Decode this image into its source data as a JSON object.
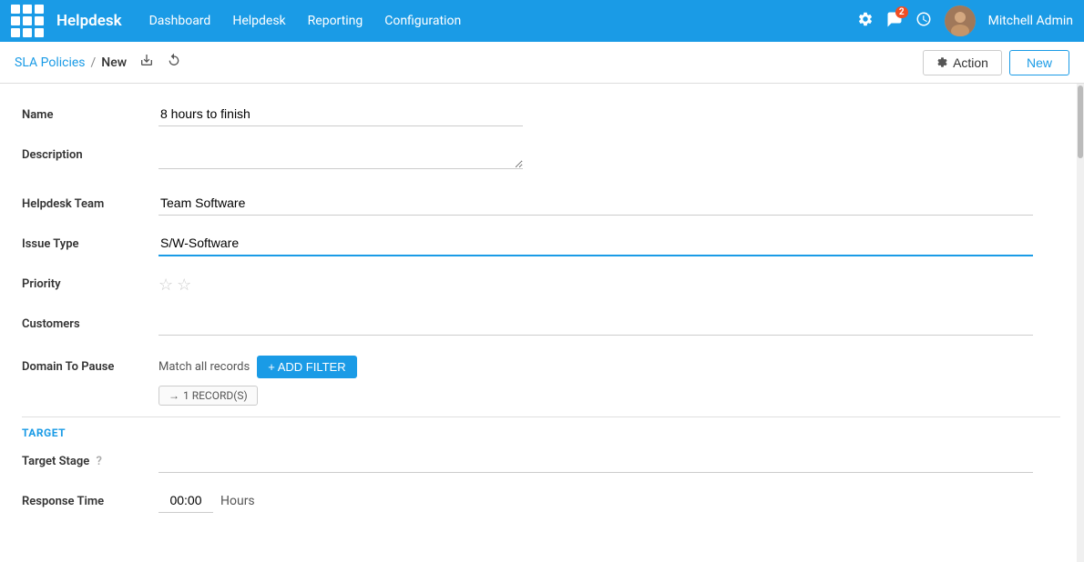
{
  "nav": {
    "app_icon": "grid-icon",
    "app_name": "Helpdesk",
    "links": [
      "Dashboard",
      "Helpdesk",
      "Reporting",
      "Configuration"
    ],
    "admin_name": "Mitchell Admin",
    "message_count": "2"
  },
  "breadcrumb": {
    "parent": "SLA Policies",
    "separator": "/",
    "current": "New",
    "action_label": "Action",
    "new_label": "New"
  },
  "form": {
    "name_label": "Name",
    "name_value": "8 hours to finish",
    "description_label": "Description",
    "helpdesk_team_label": "Helpdesk Team",
    "helpdesk_team_value": "Team Software",
    "issue_type_label": "Issue Type",
    "issue_type_value": "S/W-Software",
    "priority_label": "Priority",
    "customers_label": "Customers",
    "domain_to_pause_label": "Domain To Pause",
    "match_all_text": "Match all records",
    "add_filter_label": "+ ADD FILTER",
    "records_badge": "1 RECORD(S)"
  },
  "target": {
    "section_title": "TARGET",
    "target_stage_label": "Target Stage",
    "response_time_label": "Response Time",
    "response_time_value": "00:00",
    "hours_label": "Hours"
  }
}
